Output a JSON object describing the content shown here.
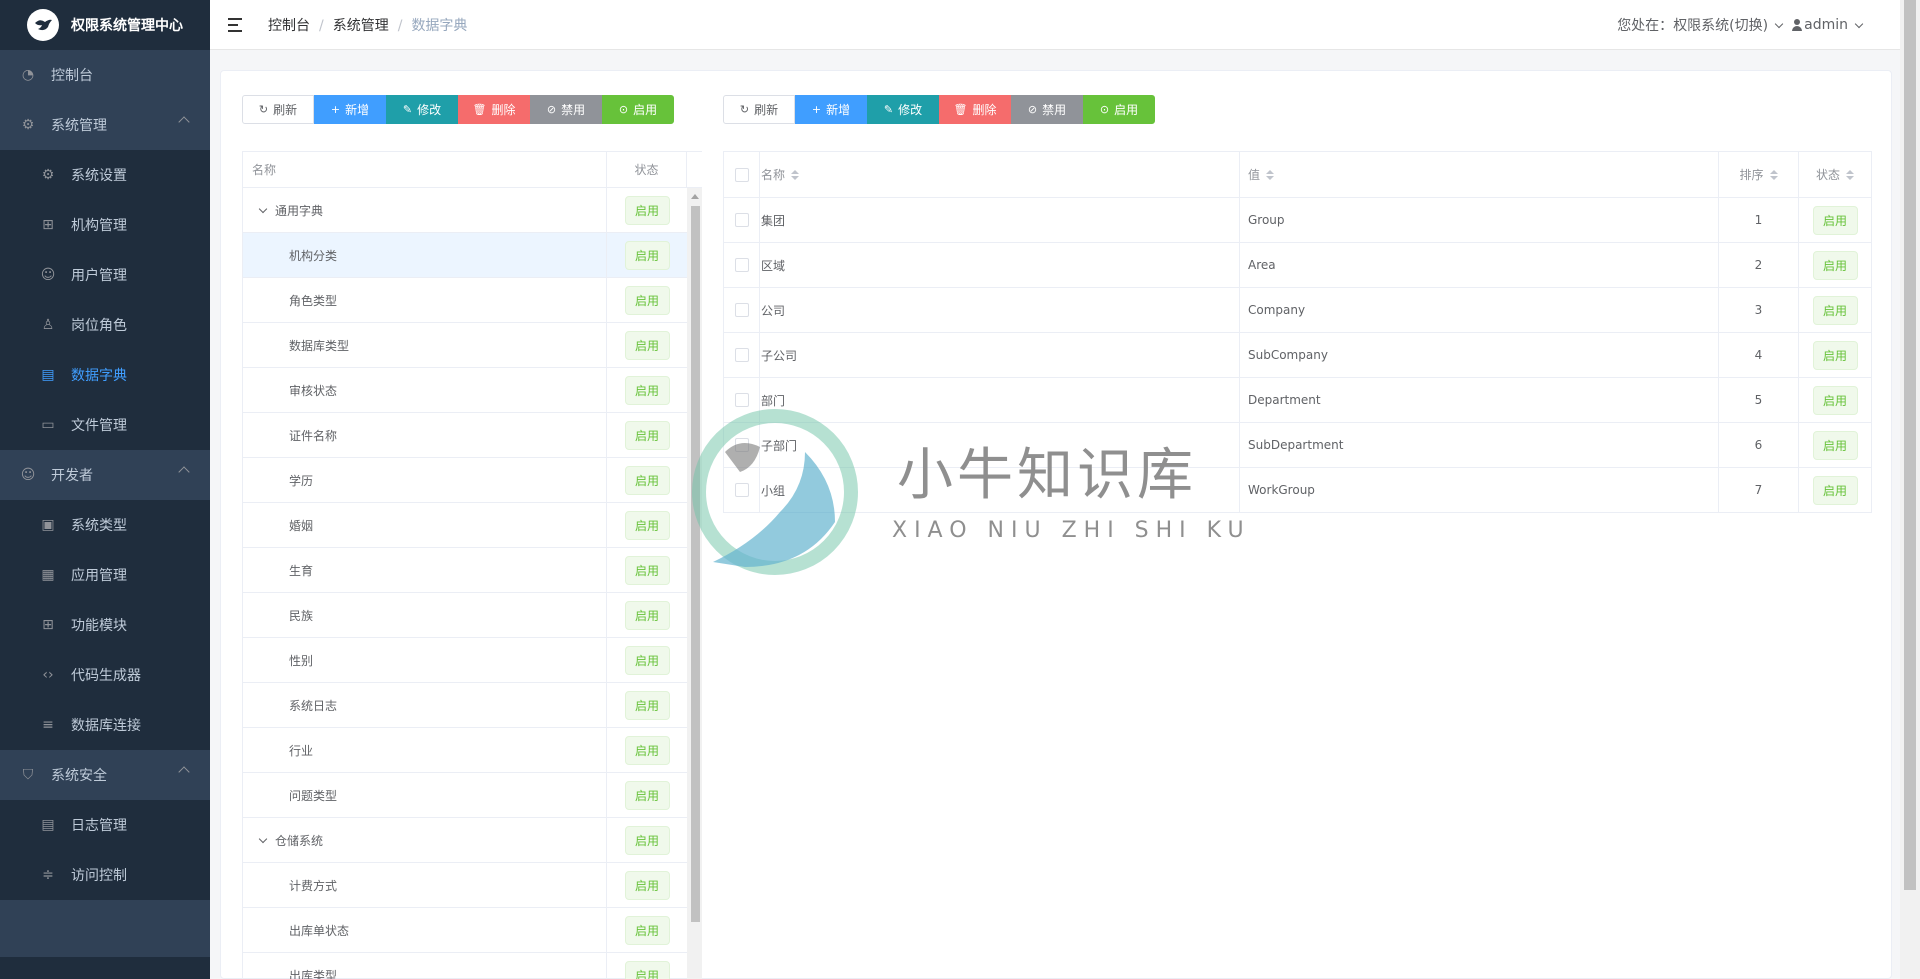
{
  "app": {
    "title": "权限系统管理中心"
  },
  "sidebar": {
    "top": {
      "label": "控制台",
      "icon": "dashboard-icon"
    },
    "groups": [
      {
        "label": "系统管理",
        "icon": "gear-icon",
        "items": [
          {
            "label": "系统设置",
            "icon": "gear-icon"
          },
          {
            "label": "机构管理",
            "icon": "org-tree-icon"
          },
          {
            "label": "用户管理",
            "icon": "user-icon"
          },
          {
            "label": "岗位角色",
            "icon": "role-icon"
          },
          {
            "label": "数据字典",
            "icon": "dictionary-icon",
            "active": true
          },
          {
            "label": "文件管理",
            "icon": "file-icon"
          }
        ]
      },
      {
        "label": "开发者",
        "icon": "developer-icon",
        "items": [
          {
            "label": "系统类型",
            "icon": "window-icon"
          },
          {
            "label": "应用管理",
            "icon": "apps-icon"
          },
          {
            "label": "功能模块",
            "icon": "modules-icon"
          },
          {
            "label": "代码生成器",
            "icon": "code-icon"
          },
          {
            "label": "数据库连接",
            "icon": "database-icon"
          }
        ]
      },
      {
        "label": "系统安全",
        "icon": "shield-icon",
        "items": [
          {
            "label": "日志管理",
            "icon": "log-icon"
          },
          {
            "label": "访问控制",
            "icon": "access-icon"
          }
        ]
      }
    ]
  },
  "header": {
    "breadcrumb": [
      "控制台",
      "系统管理",
      "数据字典"
    ],
    "location_label": "您处在：",
    "system_switch": "权限系统(切换)",
    "user": "admin"
  },
  "toolbar": {
    "refresh": "刷新",
    "add": "新增",
    "edit": "修改",
    "delete": "删除",
    "disable": "禁用",
    "enable": "启用"
  },
  "tree_table": {
    "columns": [
      "名称",
      "状态"
    ],
    "rows": [
      {
        "name": "通用字典",
        "level": 0,
        "status": "启用"
      },
      {
        "name": "机构分类",
        "level": 1,
        "status": "启用",
        "selected": true
      },
      {
        "name": "角色类型",
        "level": 1,
        "status": "启用"
      },
      {
        "name": "数据库类型",
        "level": 1,
        "status": "启用"
      },
      {
        "name": "审核状态",
        "level": 1,
        "status": "启用"
      },
      {
        "name": "证件名称",
        "level": 1,
        "status": "启用"
      },
      {
        "name": "学历",
        "level": 1,
        "status": "启用"
      },
      {
        "name": "婚姻",
        "level": 1,
        "status": "启用"
      },
      {
        "name": "生育",
        "level": 1,
        "status": "启用"
      },
      {
        "name": "民族",
        "level": 1,
        "status": "启用"
      },
      {
        "name": "性别",
        "level": 1,
        "status": "启用"
      },
      {
        "name": "系统日志",
        "level": 1,
        "status": "启用"
      },
      {
        "name": "行业",
        "level": 1,
        "status": "启用"
      },
      {
        "name": "问题类型",
        "level": 1,
        "status": "启用"
      },
      {
        "name": "仓储系统",
        "level": 0,
        "status": "启用"
      },
      {
        "name": "计费方式",
        "level": 1,
        "status": "启用"
      },
      {
        "name": "出库单状态",
        "level": 1,
        "status": "启用"
      },
      {
        "name": "出库类型",
        "level": 1,
        "status": "启用"
      }
    ]
  },
  "detail_table": {
    "columns": [
      "名称",
      "值",
      "排序",
      "状态"
    ],
    "rows": [
      {
        "name": "集团",
        "value": "Group",
        "order": "1",
        "status": "启用"
      },
      {
        "name": "区域",
        "value": "Area",
        "order": "2",
        "status": "启用"
      },
      {
        "name": "公司",
        "value": "Company",
        "order": "3",
        "status": "启用"
      },
      {
        "name": "子公司",
        "value": "SubCompany",
        "order": "4",
        "status": "启用"
      },
      {
        "name": "部门",
        "value": "Department",
        "order": "5",
        "status": "启用"
      },
      {
        "name": "子部门",
        "value": "SubDepartment",
        "order": "6",
        "status": "启用"
      },
      {
        "name": "小组",
        "value": "WorkGroup",
        "order": "7",
        "status": "启用"
      }
    ]
  },
  "watermark": {
    "title": "小牛知识库",
    "subtitle": "XIAO NIU ZHI SHI KU"
  },
  "colors": {
    "sidebar_bg": "#1f2d3d",
    "primary": "#409eff",
    "success": "#67c23a",
    "danger": "#f56c6c",
    "teal": "#1f9fa9",
    "gray": "#909399"
  }
}
